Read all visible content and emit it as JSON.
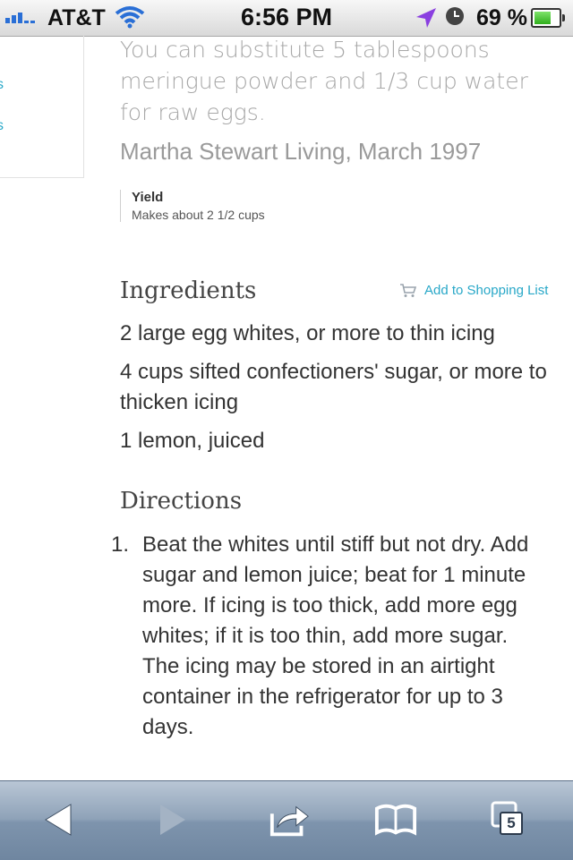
{
  "status_bar": {
    "carrier": "AT&T",
    "time": "6:56 PM",
    "battery_percent": "69 %",
    "battery_level": 0.69,
    "signal_bars": 3,
    "signal_max": 5
  },
  "sidebar": {
    "links": [
      {
        "label": "s"
      },
      {
        "label": "s"
      }
    ]
  },
  "recipe": {
    "intro": "You can substitute 5 tablespoons meringue powder and 1/3 cup water for raw eggs.",
    "source": "Martha Stewart Living, March 1997",
    "yield": {
      "title": "Yield",
      "value": "Makes about 2 1/2 cups"
    },
    "ingredients_title": "Ingredients",
    "add_to_shopping_list": "Add to Shopping List",
    "ingredients": [
      "2 large egg whites, or more to thin icing",
      "4 cups sifted confectioners' sugar, or more to thicken icing",
      "1 lemon, juiced"
    ],
    "directions_title": "Directions",
    "directions": [
      {
        "number": "1.",
        "text": "Beat the whites until stiff but not dry. Add sugar and lemon juice; beat for 1 minute more. If icing is too thick, add more egg whites; if it is too thin, add more sugar. The icing may be stored in an airtight container in the refrigerator for up to 3 days."
      }
    ]
  },
  "toolbar": {
    "tabs_count": "5",
    "icons": [
      "back-arrow-icon",
      "forward-arrow-icon",
      "share-icon",
      "bookmarks-icon",
      "tabs-icon"
    ]
  },
  "colors": {
    "link": "#29a8c8",
    "toolbar": "#8ea2b8",
    "signal": "#2a6fd6"
  }
}
